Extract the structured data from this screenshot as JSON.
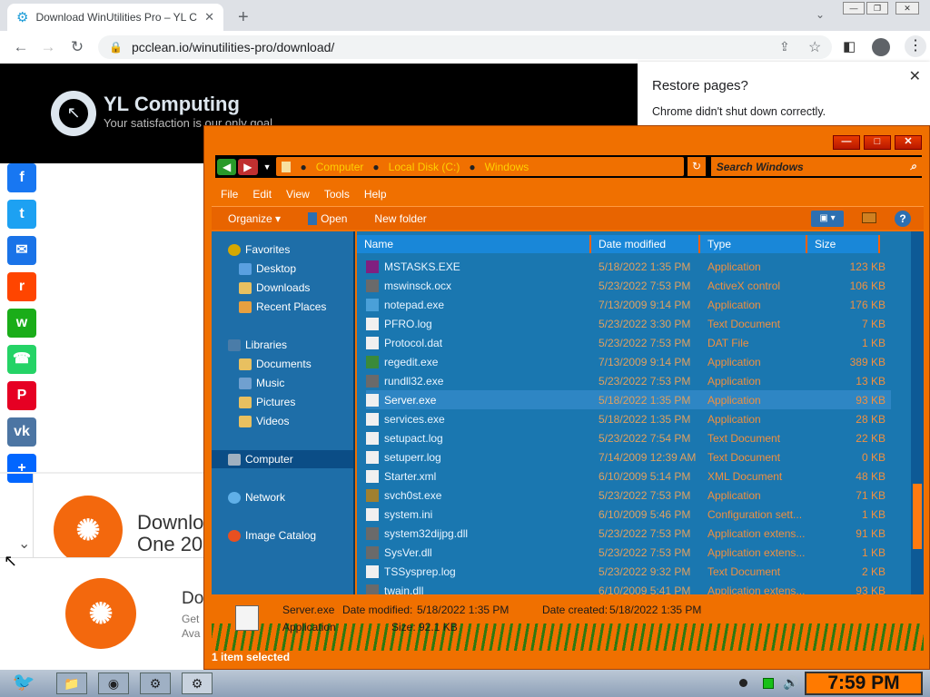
{
  "browser": {
    "tab_title": "Download WinUtilities Pro – YL C",
    "url": "pcclean.io/winutilities-pro/download/"
  },
  "site": {
    "brand": "YL Computing",
    "tagline": "Your satisfaction is our only goal",
    "download_heading_1": "Downlo",
    "download_heading_1b": "One 20",
    "download_heading_2": "Do",
    "sub_text_1": "Get",
    "sub_text_2": "Ava"
  },
  "share_buttons": [
    {
      "name": "facebook",
      "glyph": "f",
      "color": "#1877f2"
    },
    {
      "name": "twitter",
      "glyph": "t",
      "color": "#1da1f2"
    },
    {
      "name": "email",
      "glyph": "✉",
      "color": "#1a73e8"
    },
    {
      "name": "reddit",
      "glyph": "r",
      "color": "#ff4500"
    },
    {
      "name": "wechat",
      "glyph": "w",
      "color": "#1aad19"
    },
    {
      "name": "whatsapp",
      "glyph": "☎",
      "color": "#25d366"
    },
    {
      "name": "pinterest",
      "glyph": "P",
      "color": "#e60023"
    },
    {
      "name": "vk",
      "glyph": "vk",
      "color": "#4c75a3"
    },
    {
      "name": "share",
      "glyph": "+",
      "color": "#0166ff"
    }
  ],
  "restore": {
    "title": "Restore pages?",
    "message": "Chrome didn't shut down correctly."
  },
  "explorer": {
    "breadcrumb": [
      "Computer",
      "Local Disk (C:)",
      "Windows"
    ],
    "search_placeholder": "Search Windows",
    "menu": [
      "File",
      "Edit",
      "View",
      "Tools",
      "Help"
    ],
    "commands": {
      "organize": "Organize",
      "open": "Open",
      "new_folder": "New folder"
    },
    "nav": {
      "favorites": "Favorites",
      "desktop": "Desktop",
      "downloads": "Downloads",
      "recent": "Recent Places",
      "libraries": "Libraries",
      "documents": "Documents",
      "music": "Music",
      "pictures": "Pictures",
      "videos": "Videos",
      "computer": "Computer",
      "network": "Network",
      "image_catalog": "Image Catalog"
    },
    "columns": {
      "name": "Name",
      "date": "Date modified",
      "type": "Type",
      "size": "Size"
    },
    "files": [
      {
        "name": "MSTASKS.EXE",
        "date": "5/18/2022 1:35 PM",
        "type": "Application",
        "size": "123 KB"
      },
      {
        "name": "mswinsck.ocx",
        "date": "5/23/2022 7:53 PM",
        "type": "ActiveX control",
        "size": "106 KB"
      },
      {
        "name": "notepad.exe",
        "date": "7/13/2009 9:14 PM",
        "type": "Application",
        "size": "176 KB"
      },
      {
        "name": "PFRO.log",
        "date": "5/23/2022 3:30 PM",
        "type": "Text Document",
        "size": "7 KB"
      },
      {
        "name": "Protocol.dat",
        "date": "5/23/2022 7:53 PM",
        "type": "DAT File",
        "size": "1 KB"
      },
      {
        "name": "regedit.exe",
        "date": "7/13/2009 9:14 PM",
        "type": "Application",
        "size": "389 KB"
      },
      {
        "name": "rundll32.exe",
        "date": "5/23/2022 7:53 PM",
        "type": "Application",
        "size": "13 KB"
      },
      {
        "name": "Server.exe",
        "date": "5/18/2022 1:35 PM",
        "type": "Application",
        "size": "93 KB"
      },
      {
        "name": "services.exe",
        "date": "5/18/2022 1:35 PM",
        "type": "Application",
        "size": "28 KB"
      },
      {
        "name": "setupact.log",
        "date": "5/23/2022 7:54 PM",
        "type": "Text Document",
        "size": "22 KB"
      },
      {
        "name": "setuperr.log",
        "date": "7/14/2009 12:39 AM",
        "type": "Text Document",
        "size": "0 KB"
      },
      {
        "name": "Starter.xml",
        "date": "6/10/2009 5:14 PM",
        "type": "XML Document",
        "size": "48 KB"
      },
      {
        "name": "svch0st.exe",
        "date": "5/23/2022 7:53 PM",
        "type": "Application",
        "size": "71 KB"
      },
      {
        "name": "system.ini",
        "date": "6/10/2009 5:46 PM",
        "type": "Configuration sett...",
        "size": "1 KB"
      },
      {
        "name": "system32dijpg.dll",
        "date": "5/23/2022 7:53 PM",
        "type": "Application extens...",
        "size": "91 KB"
      },
      {
        "name": "SysVer.dll",
        "date": "5/23/2022 7:53 PM",
        "type": "Application extens...",
        "size": "1 KB"
      },
      {
        "name": "TSSysprep.log",
        "date": "5/23/2022 9:32 PM",
        "type": "Text Document",
        "size": "2 KB"
      },
      {
        "name": "twain.dll",
        "date": "6/10/2009 5:41 PM",
        "type": "Application extens...",
        "size": "93 KB"
      }
    ],
    "selected_index": 7,
    "details": {
      "name": "Server.exe",
      "modified_label": "Date modified:",
      "modified": "5/18/2022 1:35 PM",
      "created_label": "Date created:",
      "created": "5/18/2022 1:35 PM",
      "type": "Application",
      "size_label": "Size:",
      "size": "92.1 KB"
    },
    "status": "1 item selected"
  },
  "taskbar": {
    "clock": "7:59 PM"
  }
}
